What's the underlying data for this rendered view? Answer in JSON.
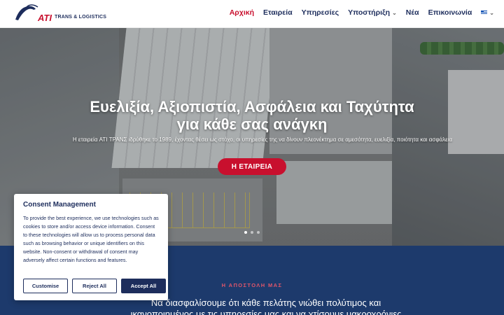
{
  "header": {
    "logo_text": "ATI",
    "logo_subtext": "TRANS & LOGISTICS",
    "nav": [
      {
        "label": "Αρχική",
        "active": true
      },
      {
        "label": "Εταιρεία"
      },
      {
        "label": "Υπηρεσίες"
      },
      {
        "label": "Υποστήριξη",
        "has_dropdown": true
      },
      {
        "label": "Νέα"
      },
      {
        "label": "Επικοινωνία"
      }
    ],
    "language_icon": "greek-flag-icon"
  },
  "hero": {
    "title_line1": "Ευελιξία, Αξιοπιστία, Ασφάλεια και Ταχύτητα",
    "title_line2": "για κάθε σας ανάγκη",
    "subtitle": "Η εταιρεία ATI ΤΡΑΝΣ ιδρύθηκε το 1989, έχοντας θέσει ως στόχο, οι υπηρεσίες της να δίνουν πλεονέκτημα σε αμεσότητα, ευελιξία, ποιότητα και ασφάλεια",
    "button_label": "Η ΕΤΑΙΡΕΙΑ",
    "slides": 3,
    "active_slide": 1
  },
  "mission": {
    "label": "Η ΑΠΟΣΤΟΛΗ ΜΑΣ",
    "text_line1": "Να διασφαλίσουμε ότι κάθε πελάτης νιώθει πολύτιμος και",
    "text_line2": "ικανοποιημένος με τις υπηρεσίες μας και να χτίσουμε μακροχρόνιες"
  },
  "consent": {
    "title": "Consent Management",
    "text": "To provide the best experience, we use technologies such as cookies to store and/or access device information. Consent to these technologies will allow us to process personal data such as browsing behavior or unique identifiers on this website. Non-consent or withdrawal of consent may adversely affect certain functions and features.",
    "customise_label": "Customise",
    "reject_label": "Reject All",
    "accept_label": "Accept All"
  },
  "colors": {
    "brand_red": "#c8102e",
    "brand_navy": "#1d2d5c",
    "mission_bg": "#1d3a6c"
  }
}
